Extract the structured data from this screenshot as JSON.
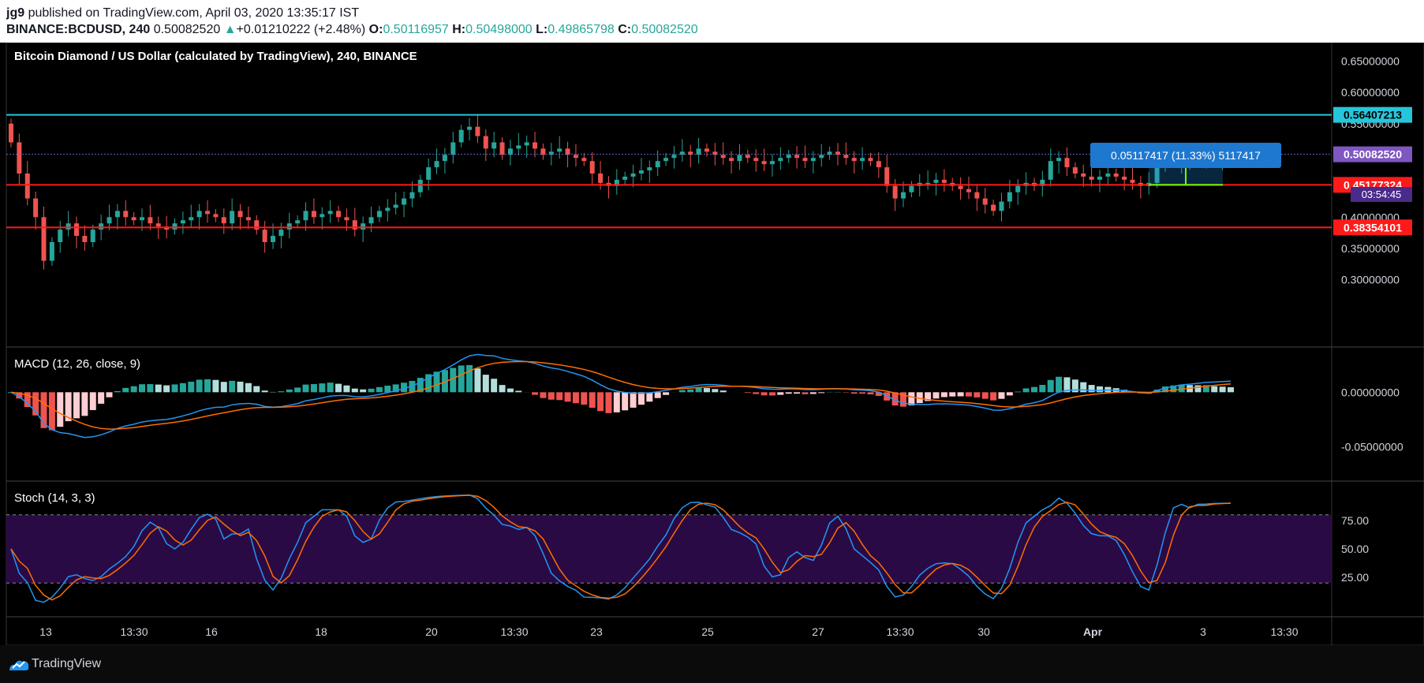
{
  "header": {
    "publisher": "jg9",
    "published_text": "published on TradingView.com, April 03, 2020 13:35:17 IST",
    "symbol": "BINANCE:BCDUSD, 240",
    "last": "0.50082520",
    "change": "+0.01210222 (+2.48%)",
    "o_label": "O:",
    "o_value": "0.50116957",
    "h_label": "H:",
    "h_value": "0.50498000",
    "l_label": "L:",
    "l_value": "0.49865798",
    "c_label": "C:",
    "c_value": "0.50082520"
  },
  "main": {
    "title": "Bitcoin Diamond / US Dollar (calculated by TradingView), 240, BINANCE",
    "measure_text": "0.05117417 (11.33%) 5117417",
    "countdown": "03:54:45"
  },
  "macd": {
    "title": "MACD (12, 26, close, 9)"
  },
  "stoch": {
    "title": "Stoch (14, 3, 3)"
  },
  "footer": {
    "brand": "TradingView"
  },
  "colors": {
    "up": "#26a69a",
    "down": "#ef5350",
    "resistance": "#26c6da",
    "support": "#ff1a1a",
    "macd_line": "#2196f3",
    "signal_line": "#ff6d00",
    "stoch_band": "#2a0a45",
    "last_price": "#7e57c2"
  },
  "chart_data": [
    {
      "type": "candlestick",
      "name": "price",
      "ylim": [
        0.26,
        0.68
      ],
      "y_ticks": [
        0.3,
        0.35,
        0.4,
        0.45,
        0.5,
        0.55,
        0.6,
        0.65
      ],
      "y_tick_labels": [
        "0.30000000",
        "0.35000000",
        "0.40000000",
        "0.45000000",
        "0.50000000",
        "0.55000000",
        "0.60000000",
        "0.65000000"
      ],
      "x_labels": [
        "13",
        "13:30",
        "16",
        "18",
        "20",
        "13:30",
        "23",
        "25",
        "27",
        "13:30",
        "30",
        "Apr",
        "3",
        "13:30"
      ],
      "horizontal_lines": [
        {
          "value": 0.56407213,
          "label": "0.56407213",
          "color": "#26c6da"
        },
        {
          "value": 0.45177324,
          "label": "0.45177324",
          "color": "#ff1a1a"
        },
        {
          "value": 0.38354101,
          "label": "0.38354101",
          "color": "#ff1a1a"
        }
      ],
      "last_price": {
        "value": 0.5008252,
        "label": "0.50082520"
      },
      "measure": {
        "from": 0.45177,
        "to": 0.50294
      },
      "closes": [
        0.52,
        0.47,
        0.43,
        0.4,
        0.33,
        0.36,
        0.38,
        0.39,
        0.37,
        0.36,
        0.38,
        0.39,
        0.4,
        0.41,
        0.4,
        0.395,
        0.4,
        0.39,
        0.385,
        0.38,
        0.39,
        0.395,
        0.4,
        0.41,
        0.405,
        0.4,
        0.39,
        0.41,
        0.4,
        0.395,
        0.38,
        0.36,
        0.37,
        0.38,
        0.39,
        0.395,
        0.41,
        0.4,
        0.405,
        0.41,
        0.4,
        0.395,
        0.38,
        0.39,
        0.4,
        0.41,
        0.415,
        0.42,
        0.43,
        0.44,
        0.46,
        0.48,
        0.49,
        0.5,
        0.52,
        0.54,
        0.545,
        0.53,
        0.51,
        0.52,
        0.5,
        0.51,
        0.515,
        0.52,
        0.51,
        0.5,
        0.505,
        0.51,
        0.5,
        0.495,
        0.49,
        0.47,
        0.455,
        0.45,
        0.46,
        0.465,
        0.47,
        0.475,
        0.48,
        0.49,
        0.495,
        0.5,
        0.505,
        0.5,
        0.51,
        0.505,
        0.5,
        0.495,
        0.49,
        0.5,
        0.495,
        0.49,
        0.485,
        0.49,
        0.495,
        0.5,
        0.495,
        0.49,
        0.495,
        0.5,
        0.505,
        0.5,
        0.495,
        0.49,
        0.495,
        0.49,
        0.48,
        0.45,
        0.43,
        0.44,
        0.45,
        0.455,
        0.455,
        0.46,
        0.455,
        0.45,
        0.445,
        0.44,
        0.43,
        0.42,
        0.41,
        0.425,
        0.44,
        0.45,
        0.455,
        0.45,
        0.46,
        0.49,
        0.495,
        0.48,
        0.47,
        0.465,
        0.46,
        0.465,
        0.47,
        0.465,
        0.46,
        0.455,
        0.45,
        0.455,
        0.49,
        0.495,
        0.49,
        0.495,
        0.49,
        0.495,
        0.5,
        0.495,
        0.5,
        0.501
      ],
      "macd_ylim": [
        -0.08,
        0.04
      ],
      "macd_ticks": [
        0.0,
        -0.05
      ],
      "macd_tick_labels": [
        "0.00000000",
        "-0.05000000"
      ],
      "stoch_ylim": [
        0,
        100
      ],
      "stoch_ticks": [
        75,
        50,
        25
      ],
      "stoch_tick_labels": [
        "75.00",
        "50.00",
        "25.00"
      ],
      "stoch_band": [
        20,
        80
      ]
    }
  ]
}
